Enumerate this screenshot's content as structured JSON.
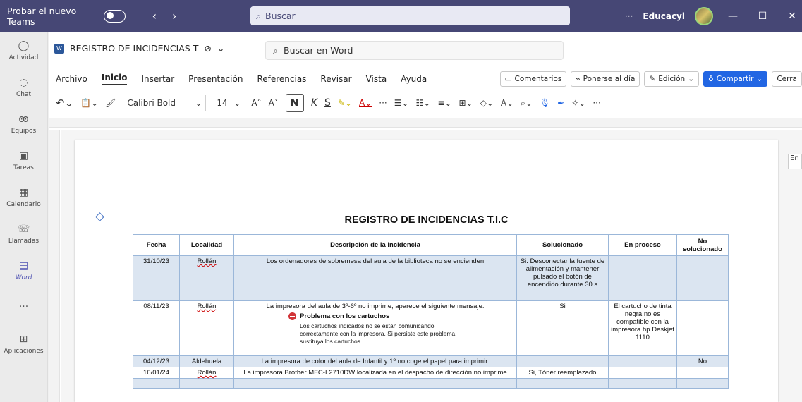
{
  "titlebar": {
    "try_teams": "Probar el nuevo Teams",
    "back": "‹",
    "forward": "›",
    "search_placeholder": "Buscar",
    "more": "···",
    "org": "Educacyl",
    "minimize": "—",
    "maximize": "☐",
    "close": "✕"
  },
  "rail": [
    {
      "label": "Actividad",
      "icon": "bell-icon"
    },
    {
      "label": "Chat",
      "icon": "chat-icon"
    },
    {
      "label": "Equipos",
      "icon": "teams-icon"
    },
    {
      "label": "Tareas",
      "icon": "tasks-icon"
    },
    {
      "label": "Calendario",
      "icon": "calendar-icon"
    },
    {
      "label": "Llamadas",
      "icon": "phone-icon"
    },
    {
      "label": "Word",
      "icon": "word-icon"
    },
    {
      "label": "···",
      "icon": "more-icon"
    },
    {
      "label": "Aplicaciones",
      "icon": "apps-icon"
    }
  ],
  "doc": {
    "name": "REGISTRO DE INCIDENCIAS T",
    "word_search": "Buscar en Word"
  },
  "menu": [
    "Archivo",
    "Inicio",
    "Insertar",
    "Presentación",
    "Referencias",
    "Revisar",
    "Vista",
    "Ayuda"
  ],
  "menu_right": {
    "comments": "Comentarios",
    "catchup": "Ponerse al día",
    "editing": "Edición",
    "share": "Compartir",
    "close": "Cerra"
  },
  "toolbar": {
    "font": "Calibri Bold",
    "size": "14",
    "bold": "N",
    "italic": "K",
    "underline": "S"
  },
  "side_tab": "En",
  "page": {
    "title": "REGISTRO DE INCIDENCIAS T.I.C"
  },
  "table": {
    "headers": [
      "Fecha",
      "Localidad",
      "Descripción de la incidencia",
      "Solucionado",
      "En proceso",
      "No solucionado"
    ],
    "rows": [
      {
        "fecha": "31/10/23",
        "localidad": "Rollán",
        "descripcion": "Los ordenadores de sobremesa del aula de la biblioteca no se encienden",
        "solucionado": "Si. Desconectar la fuente de alimentación y mantener pulsado el botón de encendido durante 30 s",
        "proceso": "",
        "no": ""
      },
      {
        "fecha": "08/11/23",
        "localidad": "Rollán",
        "descripcion": "La impresora del aula de 3º-6º no imprime, aparece el siguiente mensaje:",
        "error_title": "Problema con los cartuchos",
        "error_msg": "Los cartuchos indicados no se están comunicando correctamente con la impresora. Si persiste este problema, sustituya los cartuchos.",
        "solucionado": "Si",
        "proceso": "El cartucho de tinta negra no es compatible con la impresora hp Deskjet 1110",
        "no": ""
      },
      {
        "fecha": "04/12/23",
        "localidad": "Aldehuela",
        "descripcion": "La impresora de color del aula de Infantil y 1º no coge el papel para imprimir.",
        "solucionado": "",
        "proceso": ".",
        "no": "No"
      },
      {
        "fecha": "16/01/24",
        "localidad": "Rollán",
        "descripcion": "La impresora Brother MFC-L2710DW localizada en el despacho de dirección no imprime",
        "solucionado": "Si, Tóner reemplazado",
        "proceso": "",
        "no": ""
      }
    ]
  }
}
